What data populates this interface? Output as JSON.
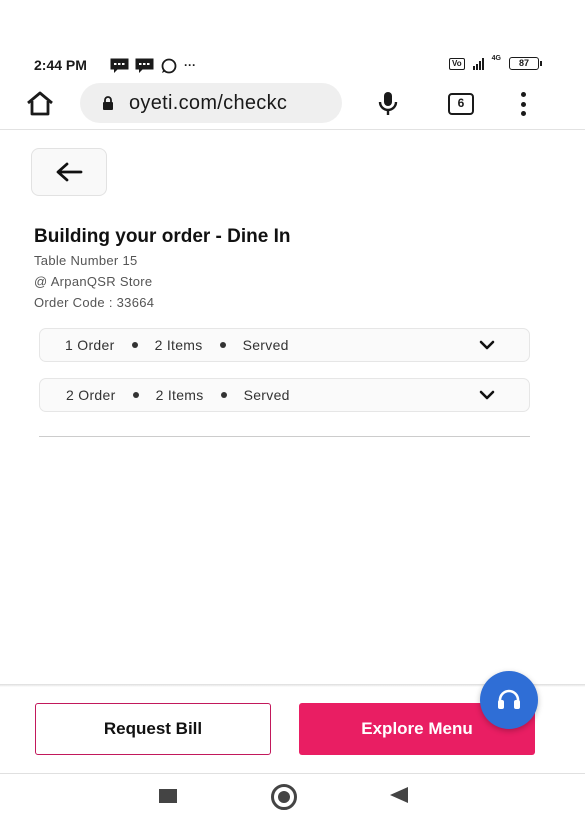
{
  "status_bar": {
    "time": "2:44 PM",
    "notification_icons": [
      "message-icon",
      "message-icon",
      "whatsapp-icon"
    ],
    "more": "···",
    "network": "4G",
    "battery": "87"
  },
  "browser": {
    "url": "oyeti.com/checkc",
    "tab_count": "6"
  },
  "page": {
    "title": "Building your order - Dine In",
    "table": "Table Number 15",
    "store": "@ ArpanQSR Store",
    "order_code": "Order Code : 33664"
  },
  "orders": [
    {
      "order": "1 Order",
      "items": "2 Items",
      "status": "Served"
    },
    {
      "order": "2 Order",
      "items": "2 Items",
      "status": "Served"
    }
  ],
  "actions": {
    "request_bill": "Request Bill",
    "explore_menu": "Explore Menu"
  },
  "colors": {
    "accent": "#e91e63",
    "fab": "#2f6ed6"
  }
}
